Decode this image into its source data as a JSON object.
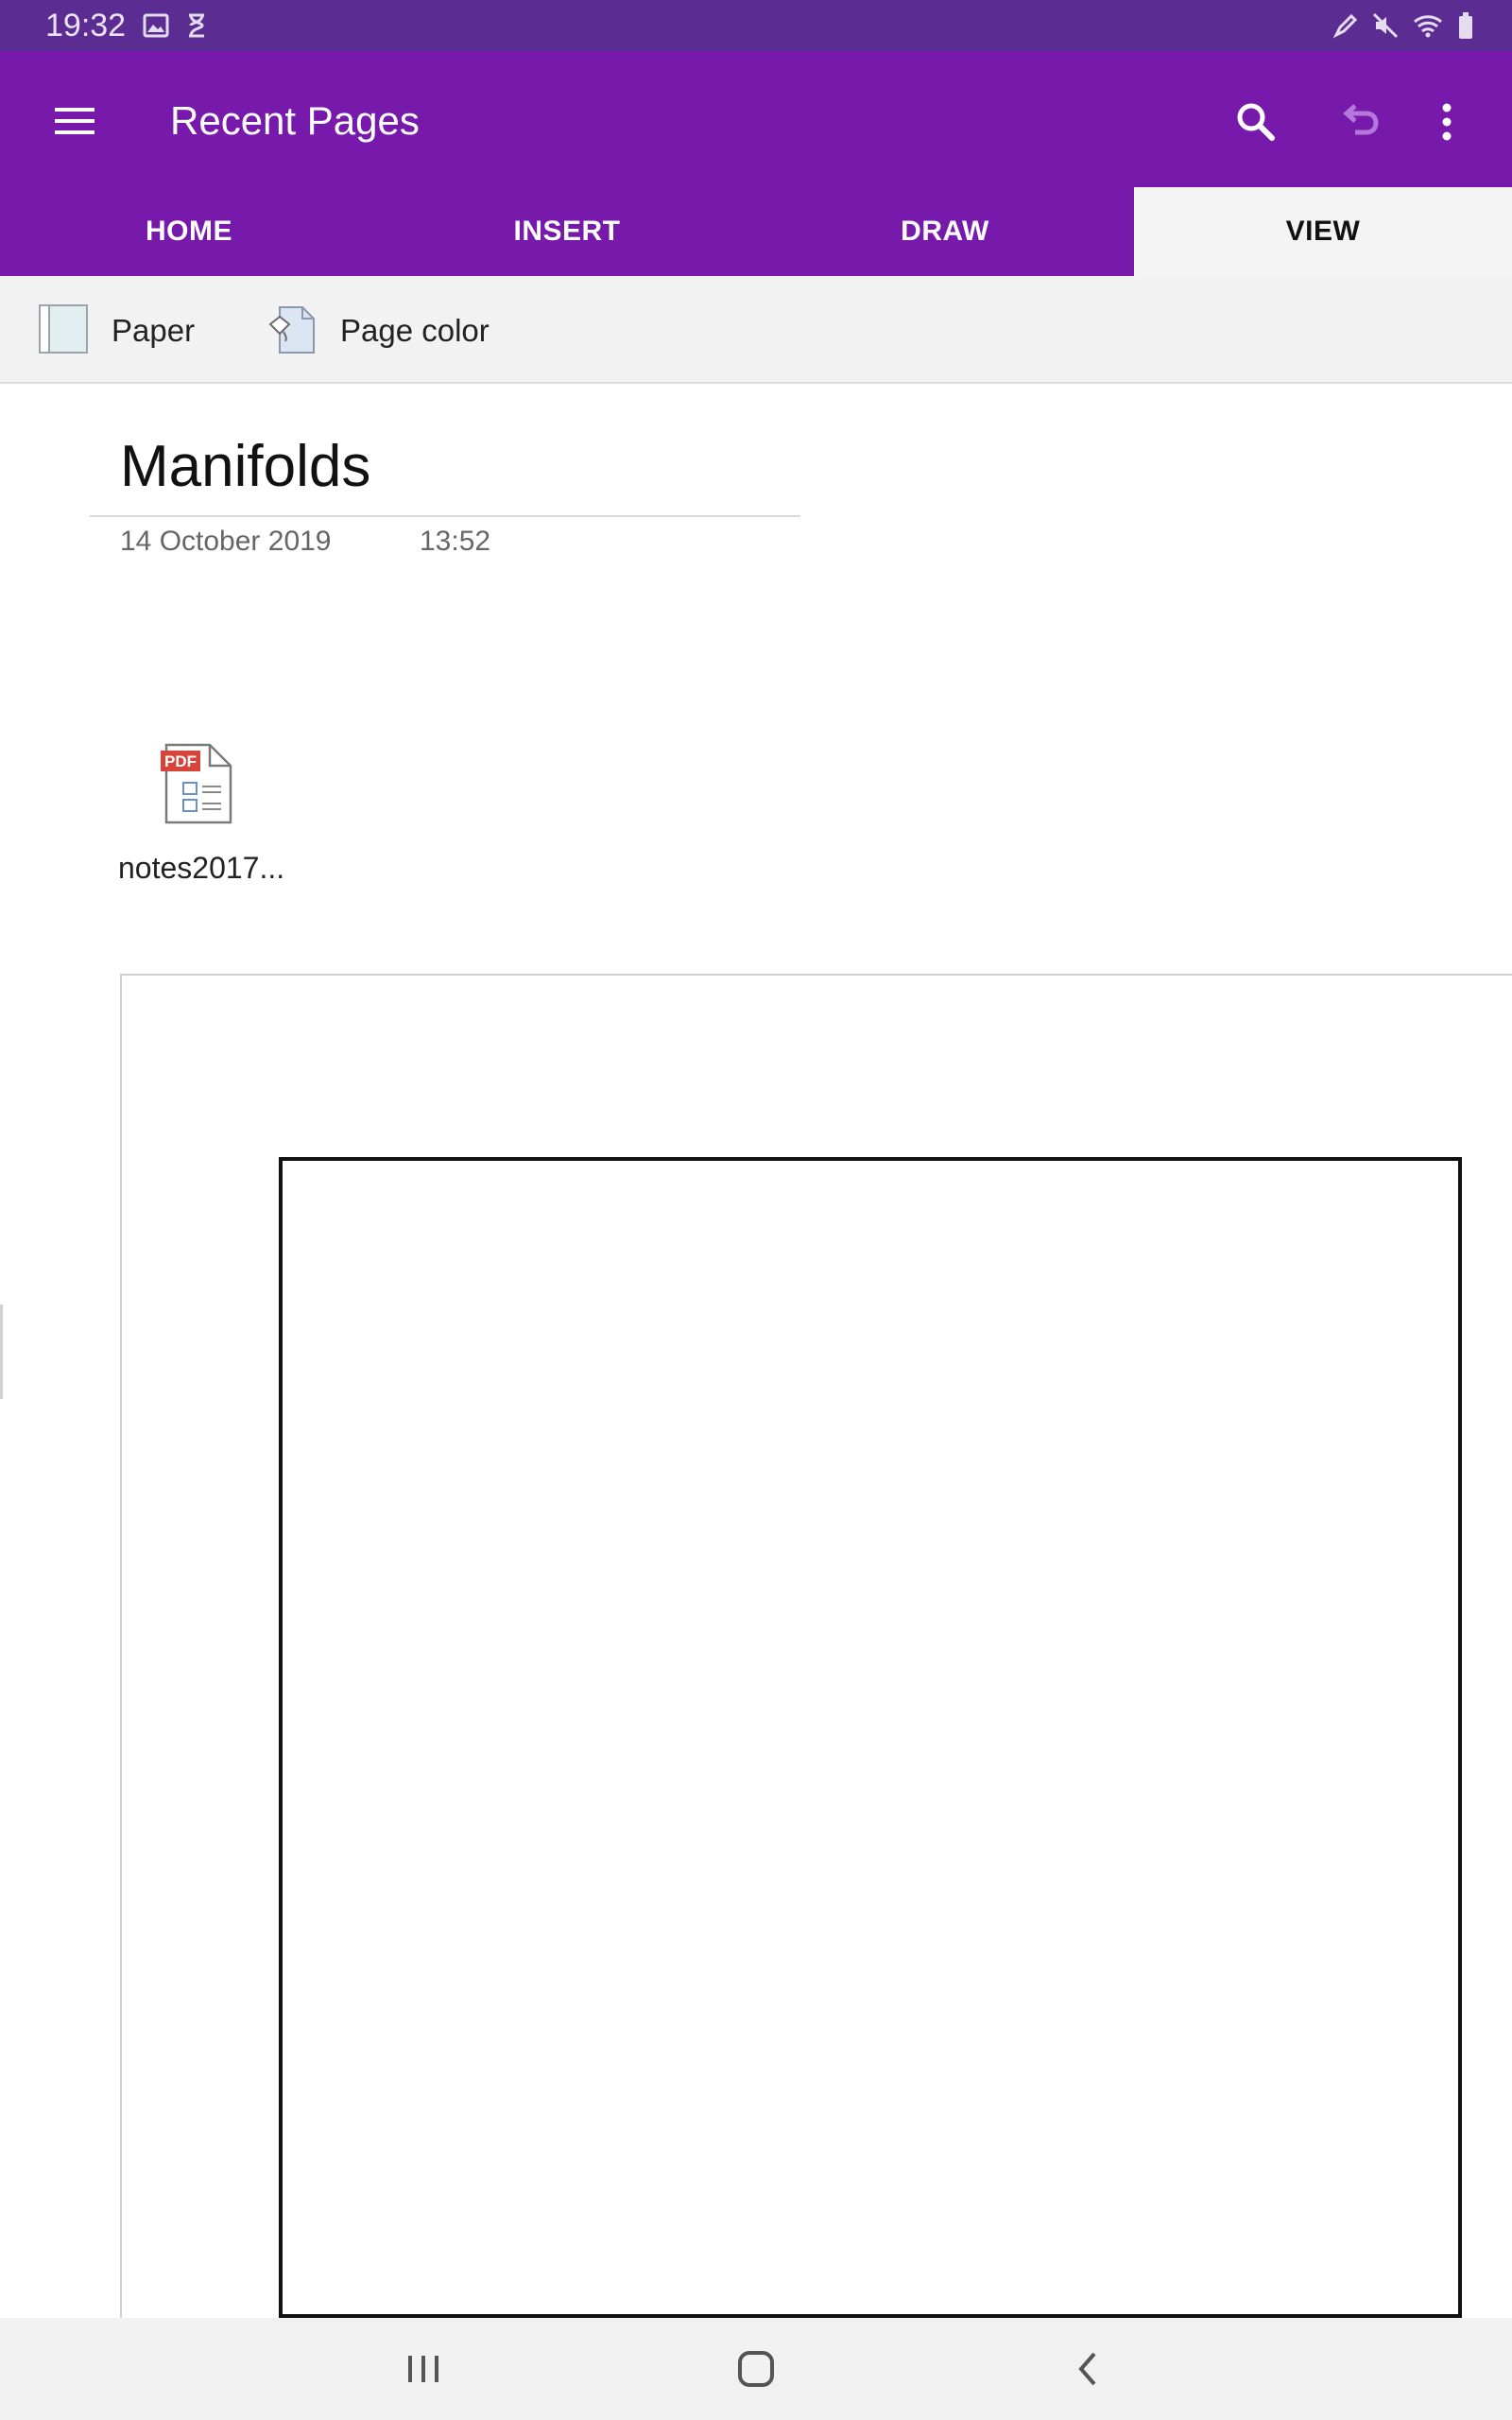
{
  "status_bar": {
    "time": "19:32",
    "icons": [
      "image-icon",
      "hourglass-icon",
      "pen-icon",
      "mute-icon",
      "wifi-icon",
      "battery-icon"
    ]
  },
  "app_bar": {
    "title": "Recent Pages",
    "icons": [
      "hamburger-menu-icon",
      "search-icon",
      "undo-icon",
      "more-vertical-icon"
    ],
    "color": "#7719aa"
  },
  "tabs": [
    {
      "label": "HOME",
      "active": false
    },
    {
      "label": "INSERT",
      "active": false
    },
    {
      "label": "DRAW",
      "active": false
    },
    {
      "label": "VIEW",
      "active": true
    }
  ],
  "toolbar": {
    "paper_label": "Paper",
    "page_color_label": "Page color"
  },
  "page": {
    "title": "Manifolds",
    "date": "14 October 2019",
    "time": "13:52",
    "attachment": {
      "name": "notes2017...",
      "badge": "PDF",
      "icon": "pdf-file-icon"
    }
  },
  "nav_bar": {
    "icons": [
      "recent-apps-icon",
      "home-icon",
      "back-icon"
    ]
  }
}
